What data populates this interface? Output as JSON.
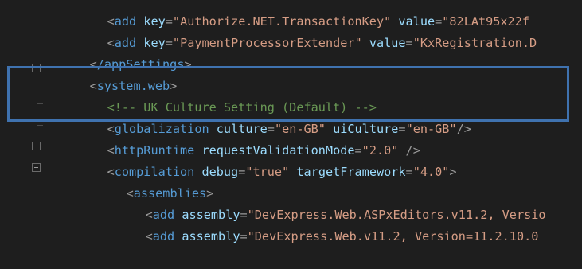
{
  "editor": {
    "lines": [
      {
        "k1": "add",
        "a1": "key",
        "v1": "\"Authorize.NET.TransactionKey\"",
        "a2": "value",
        "v2": "\"82LAt95x22f"
      },
      {
        "k1": "add",
        "a1": "key",
        "v1": "\"PaymentProcessorExtender\"",
        "a2": "value",
        "v2": "\"KxRegistration.D"
      },
      {
        "k1": "/appSettings"
      },
      {
        "k1": "system.web"
      },
      {
        "comment": "<!-- UK Culture Setting (Default) -->"
      },
      {
        "k1": "globalization",
        "a1": "culture",
        "v1": "\"en-GB\"",
        "a2": "uiCulture",
        "v2": "\"en-GB\""
      },
      {
        "k1": "httpRuntime",
        "a1": "requestValidationMode",
        "v1": "\"2.0\""
      },
      {
        "k1": "compilation",
        "a1": "debug",
        "v1": "\"true\"",
        "a2": "targetFramework",
        "v2": "\"4.0\""
      },
      {
        "k1": "assemblies"
      },
      {
        "k1": "add",
        "a1": "assembly",
        "v1": "\"DevExpress.Web.ASPxEditors.v11.2, Versio"
      },
      {
        "k1": "add",
        "a1": "assembly",
        "v1": "\"DevExpress.Web.v11.2, Version=11.2.10.0"
      }
    ]
  },
  "colors": {
    "background": "#1e1e1e",
    "tag": "#569cd6",
    "attribute": "#9cdcfe",
    "value": "#d69d85",
    "comment": "#6a9955",
    "highlight_border": "#3f72af"
  }
}
